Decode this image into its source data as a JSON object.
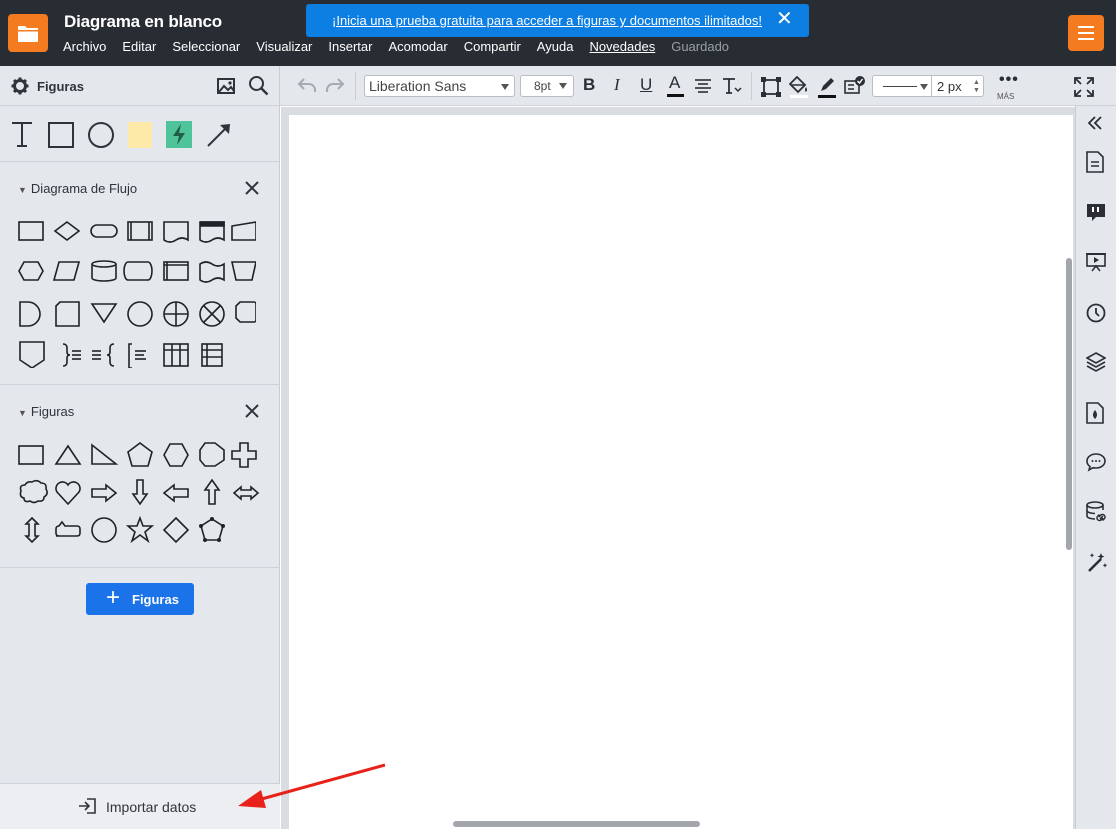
{
  "app": {
    "doc_title": "Diagrama en blanco",
    "menu": [
      "Archivo",
      "Editar",
      "Seleccionar",
      "Visualizar",
      "Insertar",
      "Acomodar",
      "Compartir",
      "Ayuda",
      "Novedades",
      "Guardado"
    ],
    "promo_text": "¡Inicia una prueba gratuita para acceder a figuras y documentos ilimitados!",
    "accent_color": "#f47b20",
    "promo_color": "#0d7ee2"
  },
  "left_panel": {
    "title": "Figuras",
    "sections": [
      {
        "title": "Diagrama de Flujo"
      },
      {
        "title": "Figuras"
      }
    ],
    "add_button": "Figuras",
    "import_button": "Importar datos"
  },
  "toolbar": {
    "font": "Liberation Sans",
    "font_size": "8pt",
    "bold": "B",
    "italic": "I",
    "underline": "U",
    "font_color": "A",
    "line_width": "2 px",
    "more": "MÁS"
  }
}
